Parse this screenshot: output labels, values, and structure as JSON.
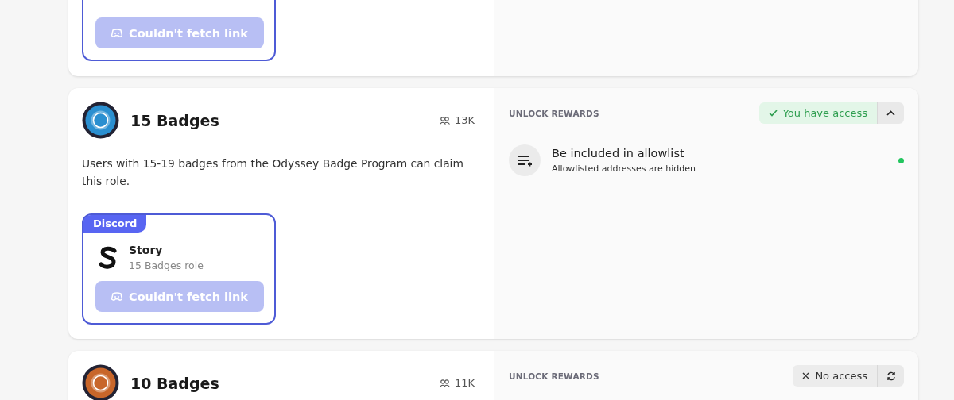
{
  "cards": [
    {
      "role_box": {
        "button": {
          "label": "Couldn't fetch link",
          "disabled": true
        }
      }
    },
    {
      "badge": {
        "color": "#2a8fd0"
      },
      "title": "15 Badges",
      "members": "13K",
      "description": "Users with 15-19 badges from the Odyssey Badge Program can claim this role.",
      "role_box": {
        "tag": "Discord",
        "server": "Story",
        "role": "15 Badges role",
        "button": {
          "label": "Couldn't fetch link",
          "disabled": true
        }
      },
      "rewards": {
        "heading": "UNLOCK REWARDS",
        "access": {
          "kind": "granted",
          "label": "You have access"
        },
        "action": {
          "kind": "collapse"
        },
        "items": [
          {
            "title": "Be included in allowlist",
            "subtitle": "Allowlisted addresses are hidden",
            "active": true
          }
        ]
      }
    },
    {
      "badge": {
        "color": "#c8662a"
      },
      "title": "10 Badges",
      "members": "11K",
      "rewards": {
        "heading": "UNLOCK REWARDS",
        "access": {
          "kind": "denied",
          "label": "No access"
        },
        "action": {
          "kind": "refresh"
        }
      }
    }
  ]
}
